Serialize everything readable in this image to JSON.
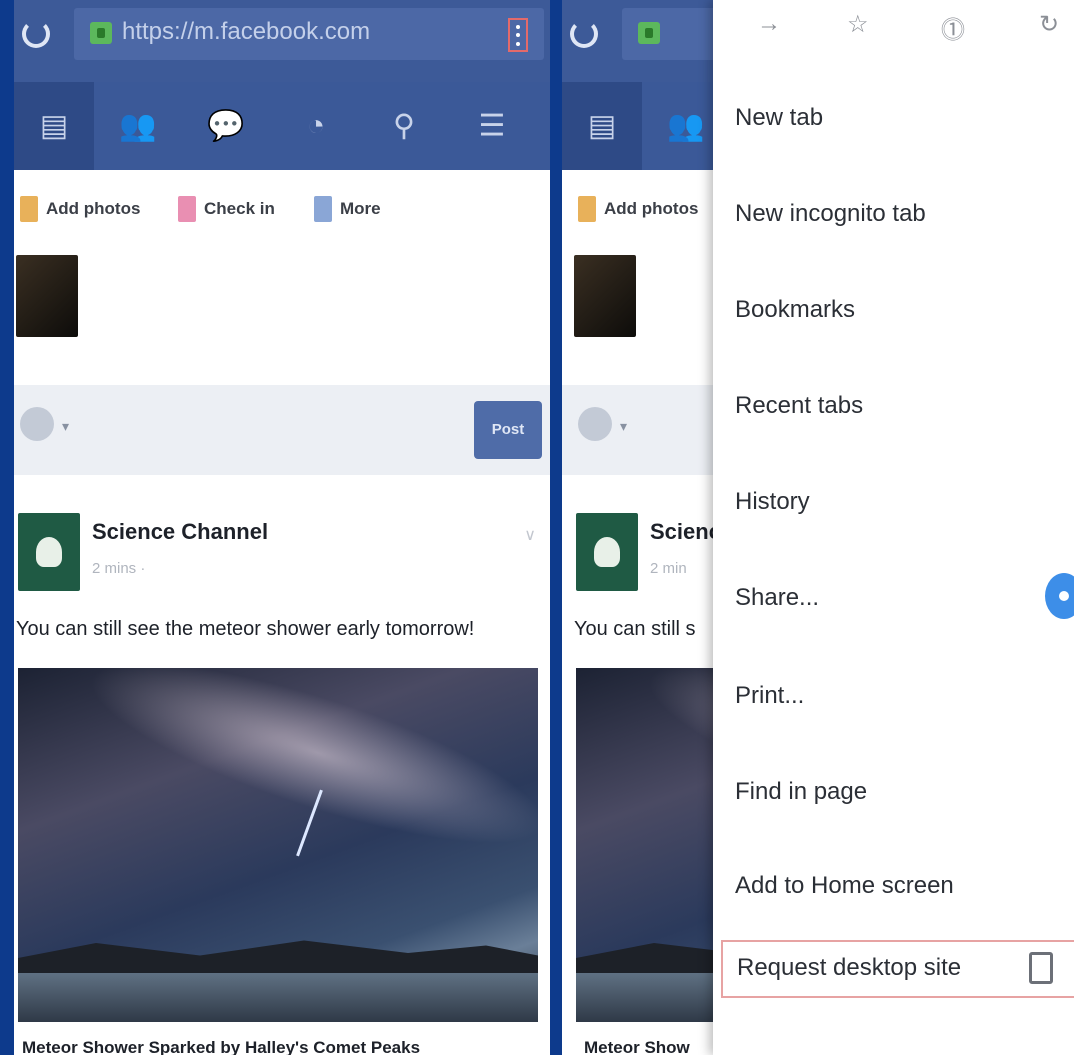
{
  "browser": {
    "url": "https://m.facebook.com"
  },
  "composer": {
    "add_photos": "Add photos",
    "check_in": "Check in",
    "more": "More",
    "post_button": "Post"
  },
  "post": {
    "page_name": "Science Channel",
    "time": "2 mins · ",
    "text": "You can still see the meteor shower early tomorrow!",
    "caption": "Meteor Shower Sparked by Halley's Comet Peaks"
  },
  "right_panel": {
    "add_photos": "Add photos",
    "page_name_partial": "Scienc",
    "time_partial": "2 min",
    "text_partial": "You can still s",
    "caption_partial": "Meteor Show"
  },
  "menu": {
    "items": [
      "New tab",
      "New incognito tab",
      "Bookmarks",
      "Recent tabs",
      "History",
      "Share...",
      "Print...",
      "Find in page",
      "Add to Home screen",
      "Request desktop site"
    ],
    "top_icons": [
      "forward-icon",
      "star-icon",
      "download-icon",
      "refresh-icon"
    ]
  },
  "colors": {
    "facebook_blue": "#3b5998",
    "menu_highlight": "#e7a3a3",
    "share_accent": "#3d8ee8"
  }
}
